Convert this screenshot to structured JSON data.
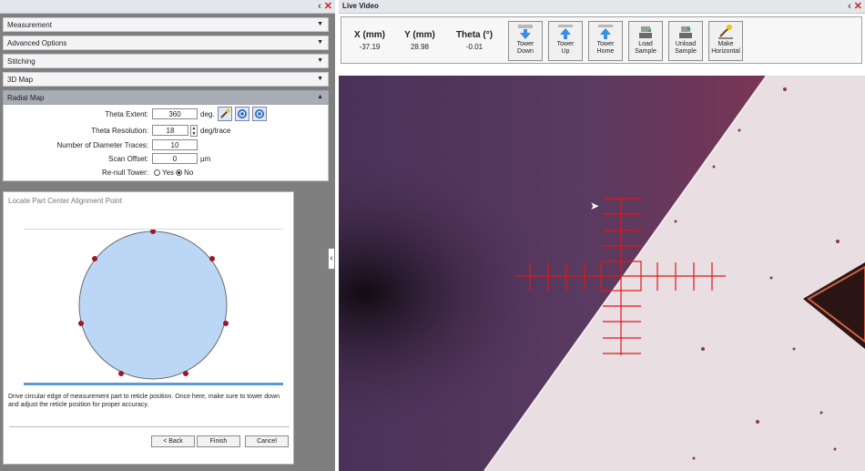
{
  "left_panel": {
    "sections": [
      {
        "label": "Measurement"
      },
      {
        "label": "Advanced Options"
      },
      {
        "label": "Stitching"
      },
      {
        "label": "3D Map"
      }
    ],
    "radial_map": {
      "header": "Radial Map",
      "theta_extent": {
        "label": "Theta Extent:",
        "value": "360",
        "unit": "deg."
      },
      "theta_resolution": {
        "label": "Theta Resolution:",
        "value": "18",
        "unit": "deg/trace"
      },
      "num_traces": {
        "label": "Number of Diameter Traces:",
        "value": "10"
      },
      "scan_offset": {
        "label": "Scan Offset:",
        "value": "0",
        "unit": "µm"
      },
      "renull": {
        "label": "Re-null Tower:",
        "yes": "Yes",
        "no": "No",
        "selected": "No"
      }
    },
    "dialog": {
      "title": "Locate Part Center Alignment Point",
      "instruction": "Drive circular edge of measurement part to reticle position. Once here, make sure to tower down and adjust the reticle position for proper accuracy.",
      "back": "< Back",
      "finish": "Finish",
      "cancel": "Cancel"
    }
  },
  "right_panel": {
    "title": "Live Video",
    "x": {
      "label": "X (mm)",
      "value": "-37.19"
    },
    "y": {
      "label": "Y (mm)",
      "value": "28.98"
    },
    "theta": {
      "label": "Theta (°)",
      "value": "-0.01"
    },
    "buttons": [
      {
        "line1": "Tower",
        "line2": "Down",
        "icon": "tower-down-icon"
      },
      {
        "line1": "Tower",
        "line2": "Up",
        "icon": "tower-up-icon"
      },
      {
        "line1": "Tower",
        "line2": "Home",
        "icon": "tower-home-icon"
      },
      {
        "line1": "Load",
        "line2": "Sample",
        "icon": "load-sample-icon"
      },
      {
        "line1": "Unload",
        "line2": "Sample",
        "icon": "unload-sample-icon"
      },
      {
        "line1": "Make",
        "line2": "Horizontal",
        "icon": "make-horizontal-icon"
      }
    ]
  },
  "colors": {
    "reticle": "#e01818",
    "circle_fill": "#bcd7f5",
    "marker": "#a01428",
    "video_dark": "#4a3158",
    "video_light": "#e9dfe2"
  }
}
